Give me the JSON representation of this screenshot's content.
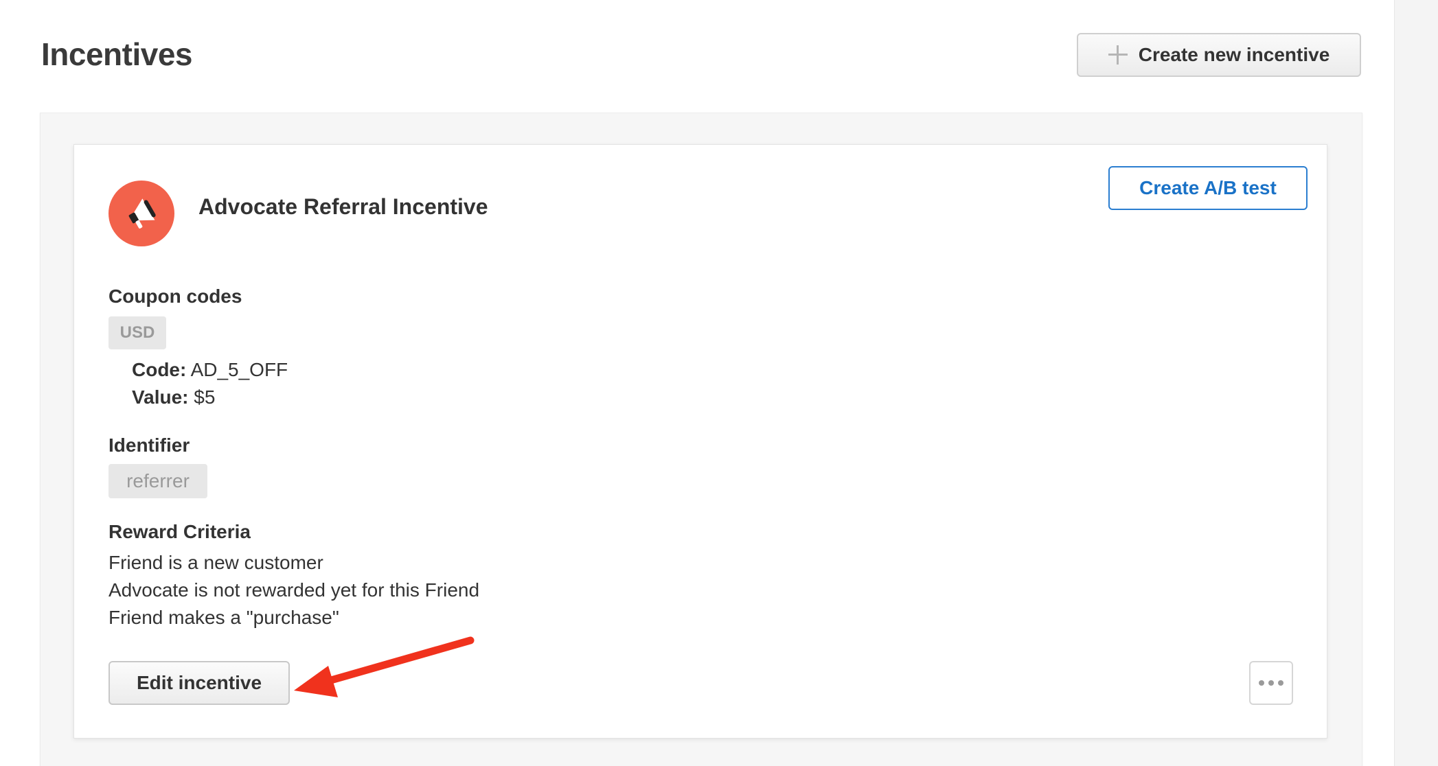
{
  "header": {
    "title": "Incentives",
    "create_button_label": "Create new incentive"
  },
  "incentive": {
    "name": "Advocate Referral Incentive",
    "ab_test_label": "Create A/B test",
    "coupon": {
      "heading": "Coupon codes",
      "currency": "USD",
      "code_label": "Code:",
      "code_value": "AD_5_OFF",
      "value_label": "Value:",
      "value_value": "$5"
    },
    "identifier": {
      "heading": "Identifier",
      "value": "referrer"
    },
    "reward_criteria": {
      "heading": "Reward Criteria",
      "items": [
        "Friend is a new customer",
        "Advocate is not rewarded yet for this Friend",
        "Friend makes a \"purchase\""
      ]
    },
    "edit_button_label": "Edit incentive"
  },
  "colors": {
    "brand_icon": "#f2624b",
    "link_blue": "#1a72c7",
    "annotation_red": "#f0321d"
  },
  "icons": {
    "create": "plus-icon",
    "incentive": "megaphone-icon",
    "more": "more-options-icon"
  }
}
